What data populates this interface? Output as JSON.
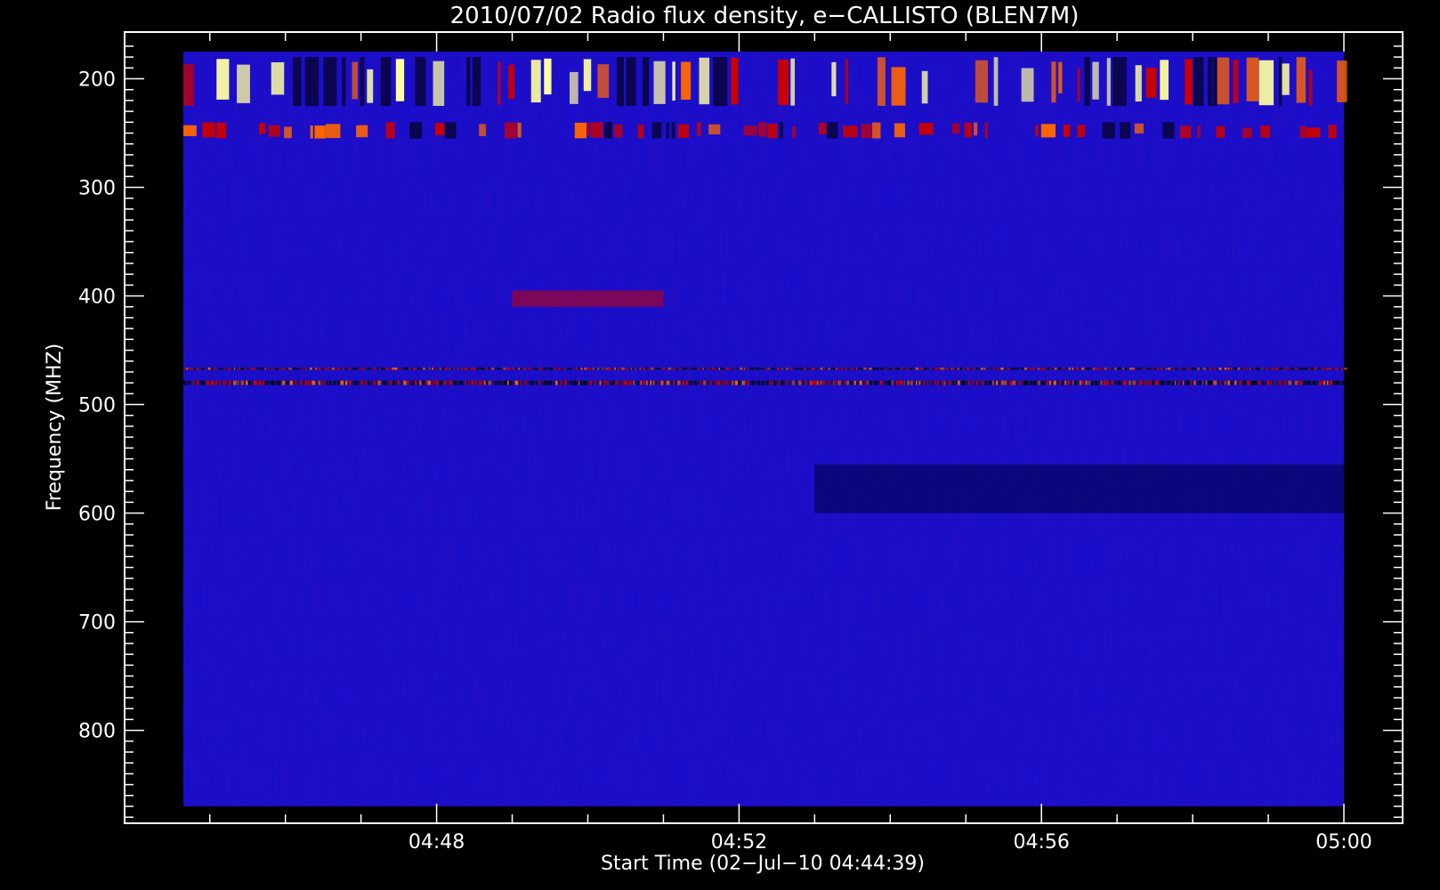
{
  "chart_data": {
    "type": "heatmap",
    "title": "2010/07/02  Radio flux density, e−CALLISTO (BLEN7M)",
    "xlabel": "Start Time (02−Jul−10 04:44:39)",
    "ylabel": "Frequency (MHZ)",
    "x_start": "04:44:39",
    "x_end": "05:00:00",
    "x_ticks": [
      "04:48",
      "04:52",
      "04:56",
      "05:00"
    ],
    "y_ticks": [
      200,
      300,
      400,
      500,
      600,
      700,
      800
    ],
    "ylim": [
      870,
      175
    ],
    "y_axis_inverted": true,
    "colormap": [
      "#000000",
      "#1010d0",
      "#cc0000",
      "#ff6600",
      "#ffffa0"
    ],
    "features": [
      {
        "name": "strong intermittent emission",
        "freq_range_mhz": [
          180,
          225
        ],
        "intensity": "high"
      },
      {
        "name": "intermittent emission",
        "freq_range_mhz": [
          240,
          255
        ],
        "intensity": "medium"
      },
      {
        "name": "enhanced band",
        "freq_range_mhz": [
          395,
          410
        ],
        "time_range": [
          "04:49",
          "04:51"
        ],
        "intensity": "medium"
      },
      {
        "name": "narrow interference line",
        "freq_range_mhz": [
          466,
          468
        ],
        "intensity": "medium"
      },
      {
        "name": "narrow interference line",
        "freq_range_mhz": [
          478,
          482
        ],
        "intensity": "high"
      },
      {
        "name": "low-intensity band",
        "freq_range_mhz": [
          555,
          600
        ],
        "time_range": [
          "04:53",
          "05:00"
        ],
        "intensity": "low"
      }
    ]
  }
}
